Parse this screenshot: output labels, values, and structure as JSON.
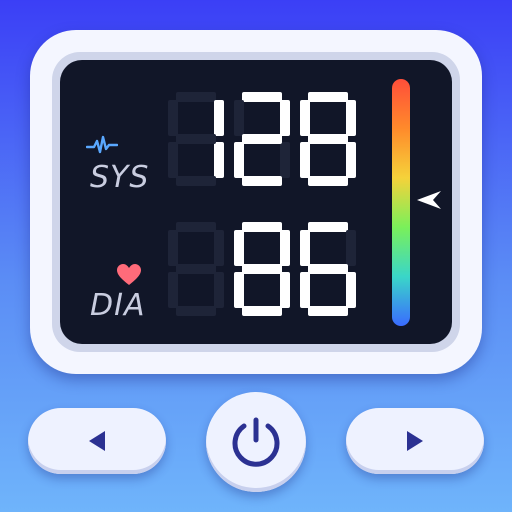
{
  "display": {
    "sys_label": "SYS",
    "dia_label": "DIA",
    "systolic": "128",
    "diastolic": "86"
  },
  "icons": {
    "pulse": "pulse-wave-icon",
    "heart": "heart-icon",
    "indicator": "arrow-pointer-icon",
    "prev": "triangle-left-icon",
    "power": "power-icon",
    "next": "triangle-right-icon"
  },
  "colors": {
    "screen": "#111628",
    "digit": "#ffffff",
    "ghost_digit": "#1e2438",
    "accent": "#2b3192",
    "heart": "#ff6b7a",
    "pulse": "#5aa8ff"
  }
}
